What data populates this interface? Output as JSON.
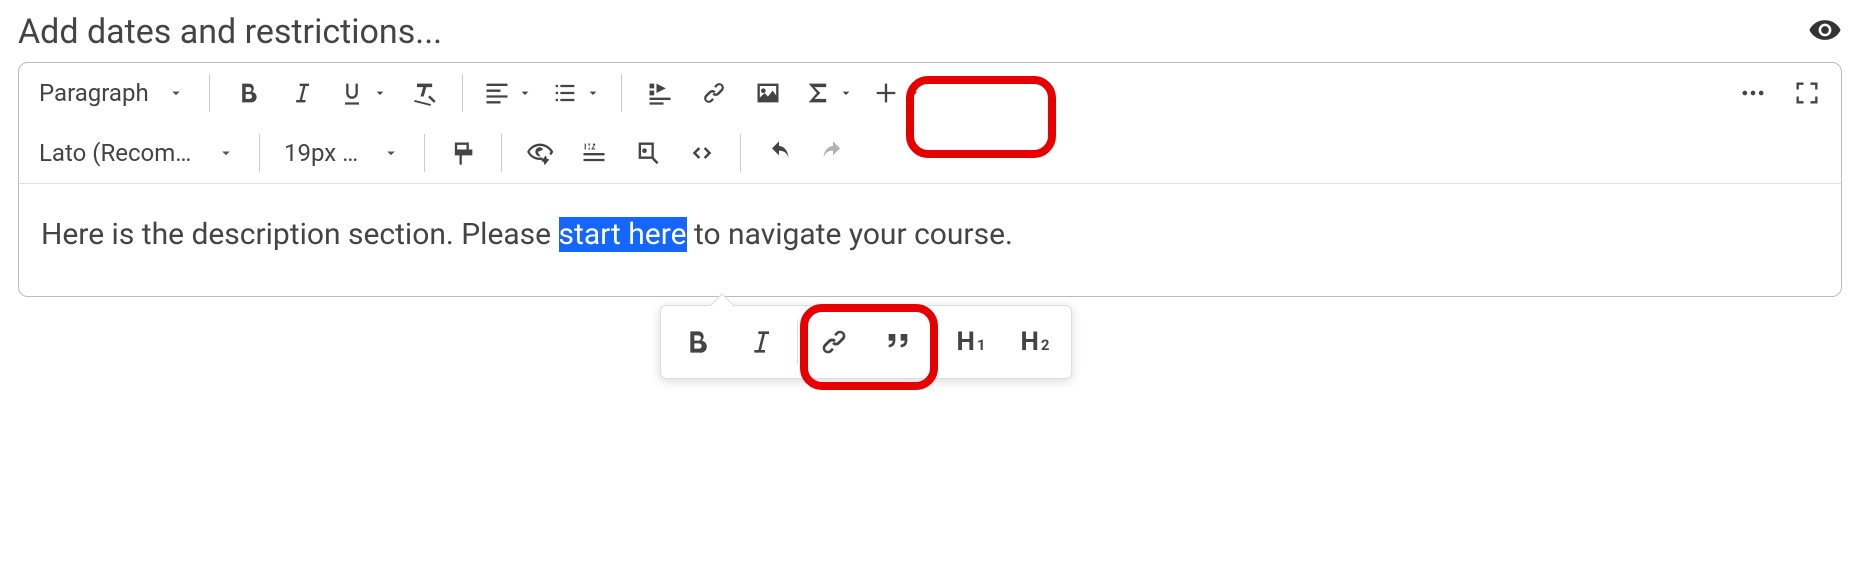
{
  "header": {
    "title": "Add dates and restrictions..."
  },
  "toolbar": {
    "paragraph_label": "Paragraph",
    "font_label": "Lato (Recom…",
    "size_label": "19px …"
  },
  "content": {
    "part1": "Here is the description section. Please ",
    "selected": "start here",
    "part2": " to navigate your course."
  },
  "popup": {
    "h1_main": "H",
    "h1_sub": "1",
    "h2_main": "H",
    "h2_sub": "2"
  }
}
